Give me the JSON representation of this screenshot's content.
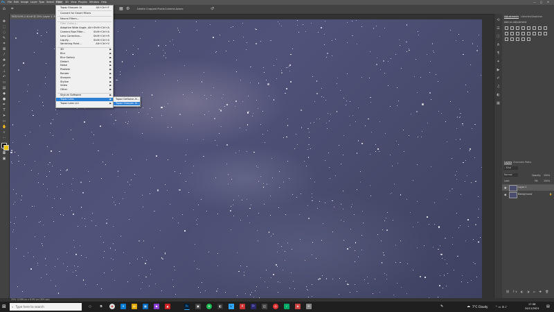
{
  "menubar": {
    "items": [
      "Ps",
      "File",
      "Edit",
      "Image",
      "Layer",
      "Type",
      "Select",
      "Filter",
      "3D",
      "View",
      "Plugins",
      "Window",
      "Help"
    ],
    "active": "Filter"
  },
  "options": {
    "select_subject": "Select Subject",
    "select_and_mask": "Select and Mask...",
    "delete_cropped": "Delete Cropped Pixels",
    "content_aware": "Content-Aware"
  },
  "document": {
    "tab_title": "70D23195-2-40.tif @ 25% (Layer 1, RGB/16)",
    "status": "25%   12288 px x 8192 px (300 ppi)"
  },
  "filter_menu": {
    "items": [
      {
        "label": "Topaz Sharpen AI",
        "shortcut": "Alt+Ctrl+F"
      },
      {
        "label": "Convert for Smart Filters"
      },
      {
        "label": "Neural Filters..."
      },
      {
        "label": "Filter Gallery...",
        "disabled": true
      },
      {
        "label": "Adaptive Wide Angle...",
        "shortcut": "Alt+Shift+Ctrl+A"
      },
      {
        "label": "Camera Raw Filter...",
        "shortcut": "Shift+Ctrl+A"
      },
      {
        "label": "Lens Correction...",
        "shortcut": "Shift+Ctrl+R"
      },
      {
        "label": "Liquify...",
        "shortcut": "Shift+Ctrl+X"
      },
      {
        "label": "Vanishing Point...",
        "shortcut": "Alt+Ctrl+V"
      },
      {
        "label": "3D",
        "submenu": true
      },
      {
        "label": "Blur",
        "submenu": true
      },
      {
        "label": "Blur Gallery",
        "submenu": true
      },
      {
        "label": "Distort",
        "submenu": true
      },
      {
        "label": "Noise",
        "submenu": true
      },
      {
        "label": "Pixelate",
        "submenu": true
      },
      {
        "label": "Render",
        "submenu": true
      },
      {
        "label": "Sharpen",
        "submenu": true
      },
      {
        "label": "Stylize",
        "submenu": true
      },
      {
        "label": "Video",
        "submenu": true
      },
      {
        "label": "Other",
        "submenu": true
      },
      {
        "label": "Skylum Software",
        "submenu": true
      },
      {
        "label": "Topaz Labs",
        "submenu": true,
        "highlighted": true
      },
      {
        "label": "Topaz Labs LLC",
        "submenu": true
      }
    ],
    "submenu": [
      {
        "label": "Topaz DeNoise AI..."
      },
      {
        "label": "Topaz Sharpen AI...",
        "highlighted": true
      }
    ]
  },
  "panels": {
    "adjustments_tabs": [
      "Adjustments",
      "Libraries",
      "Swatches"
    ],
    "add_adjustment": "Add an adjustment",
    "layers_tabs": [
      "Layers",
      "Channels",
      "Paths"
    ],
    "kind": "Kind",
    "blend_mode": "Normal",
    "opacity_label": "Opacity:",
    "opacity_value": "100%",
    "lock_label": "Lock:",
    "fill_label": "Fill:",
    "fill_value": "100%",
    "layers": [
      {
        "name": "Layer 1",
        "selected": true
      },
      {
        "name": "Background",
        "locked": true
      }
    ]
  },
  "taskbar": {
    "search_placeholder": "Type here to search",
    "weather": "7°C  Cloudy",
    "time": "17:36",
    "date": "24/11/2021"
  },
  "colors": {
    "accent": "#2b7fd4",
    "menu_bg": "#f0f0f0",
    "ui_dark": "#424242",
    "sky": "#4a4d6c"
  }
}
